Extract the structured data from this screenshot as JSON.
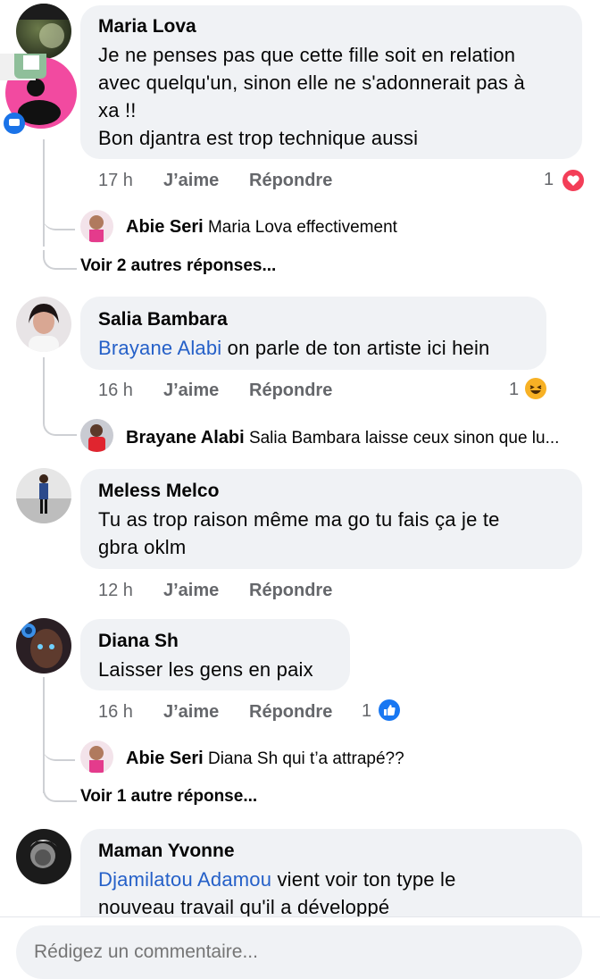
{
  "comments": [
    {
      "author": "Maria Lova",
      "text_lines": [
        "Je ne penses pas que cette fille soit en relation",
        "avec quelqu'un, sinon elle ne s'adonnerait pas à",
        "xa !!",
        "Bon djantra est trop technique aussi"
      ],
      "time": "17 h",
      "like_label": "J’aime",
      "reply_label": "Répondre",
      "reaction_count": "1",
      "reaction": "love-reaction-icon",
      "reply": {
        "author": "Abie Seri",
        "mention": "Maria Lova",
        "text": " effectivement"
      },
      "more_replies": "Voir 2 autres réponses..."
    },
    {
      "author": "Salia Bambara",
      "mention": "Brayane Alabi",
      "text": " on parle de ton artiste ici hein",
      "time": "16 h",
      "like_label": "J’aime",
      "reply_label": "Répondre",
      "reaction_count": "1",
      "reaction": "haha-reaction-icon",
      "reply": {
        "author": "Brayane Alabi",
        "text": "Salia Bambara laisse ceux sinon que lu..."
      }
    },
    {
      "author": "Meless Melco",
      "text_lines": [
        "Tu as trop raison même ma go tu fais ça je te",
        "gbra oklm"
      ],
      "time": "12 h",
      "like_label": "J’aime",
      "reply_label": "Répondre"
    },
    {
      "author": "Diana Sh",
      "text": "Laisser les gens en paix",
      "time": "16 h",
      "like_label": "J’aime",
      "reply_label": "Répondre",
      "reaction_count": "1",
      "reaction": "like-reaction-icon",
      "reply": {
        "author": "Abie Seri",
        "text": "Diana Sh  qui t’a attrapé??"
      },
      "more_replies": "Voir 1 autre réponse..."
    },
    {
      "author": "Maman Yvonne",
      "mention": "Djamilatou Adamou",
      "text": " vient voir ton type le",
      "text_line2": "nouveau travail qu'il a développé"
    }
  ],
  "composer": {
    "placeholder": "Rédigez un commentaire..."
  },
  "colors": {
    "bubble": "#f0f2f5",
    "mention": "#2560c8",
    "meta": "#65676b",
    "love": "#f33e58",
    "haha": "#f7b125",
    "like": "#1877f2"
  }
}
